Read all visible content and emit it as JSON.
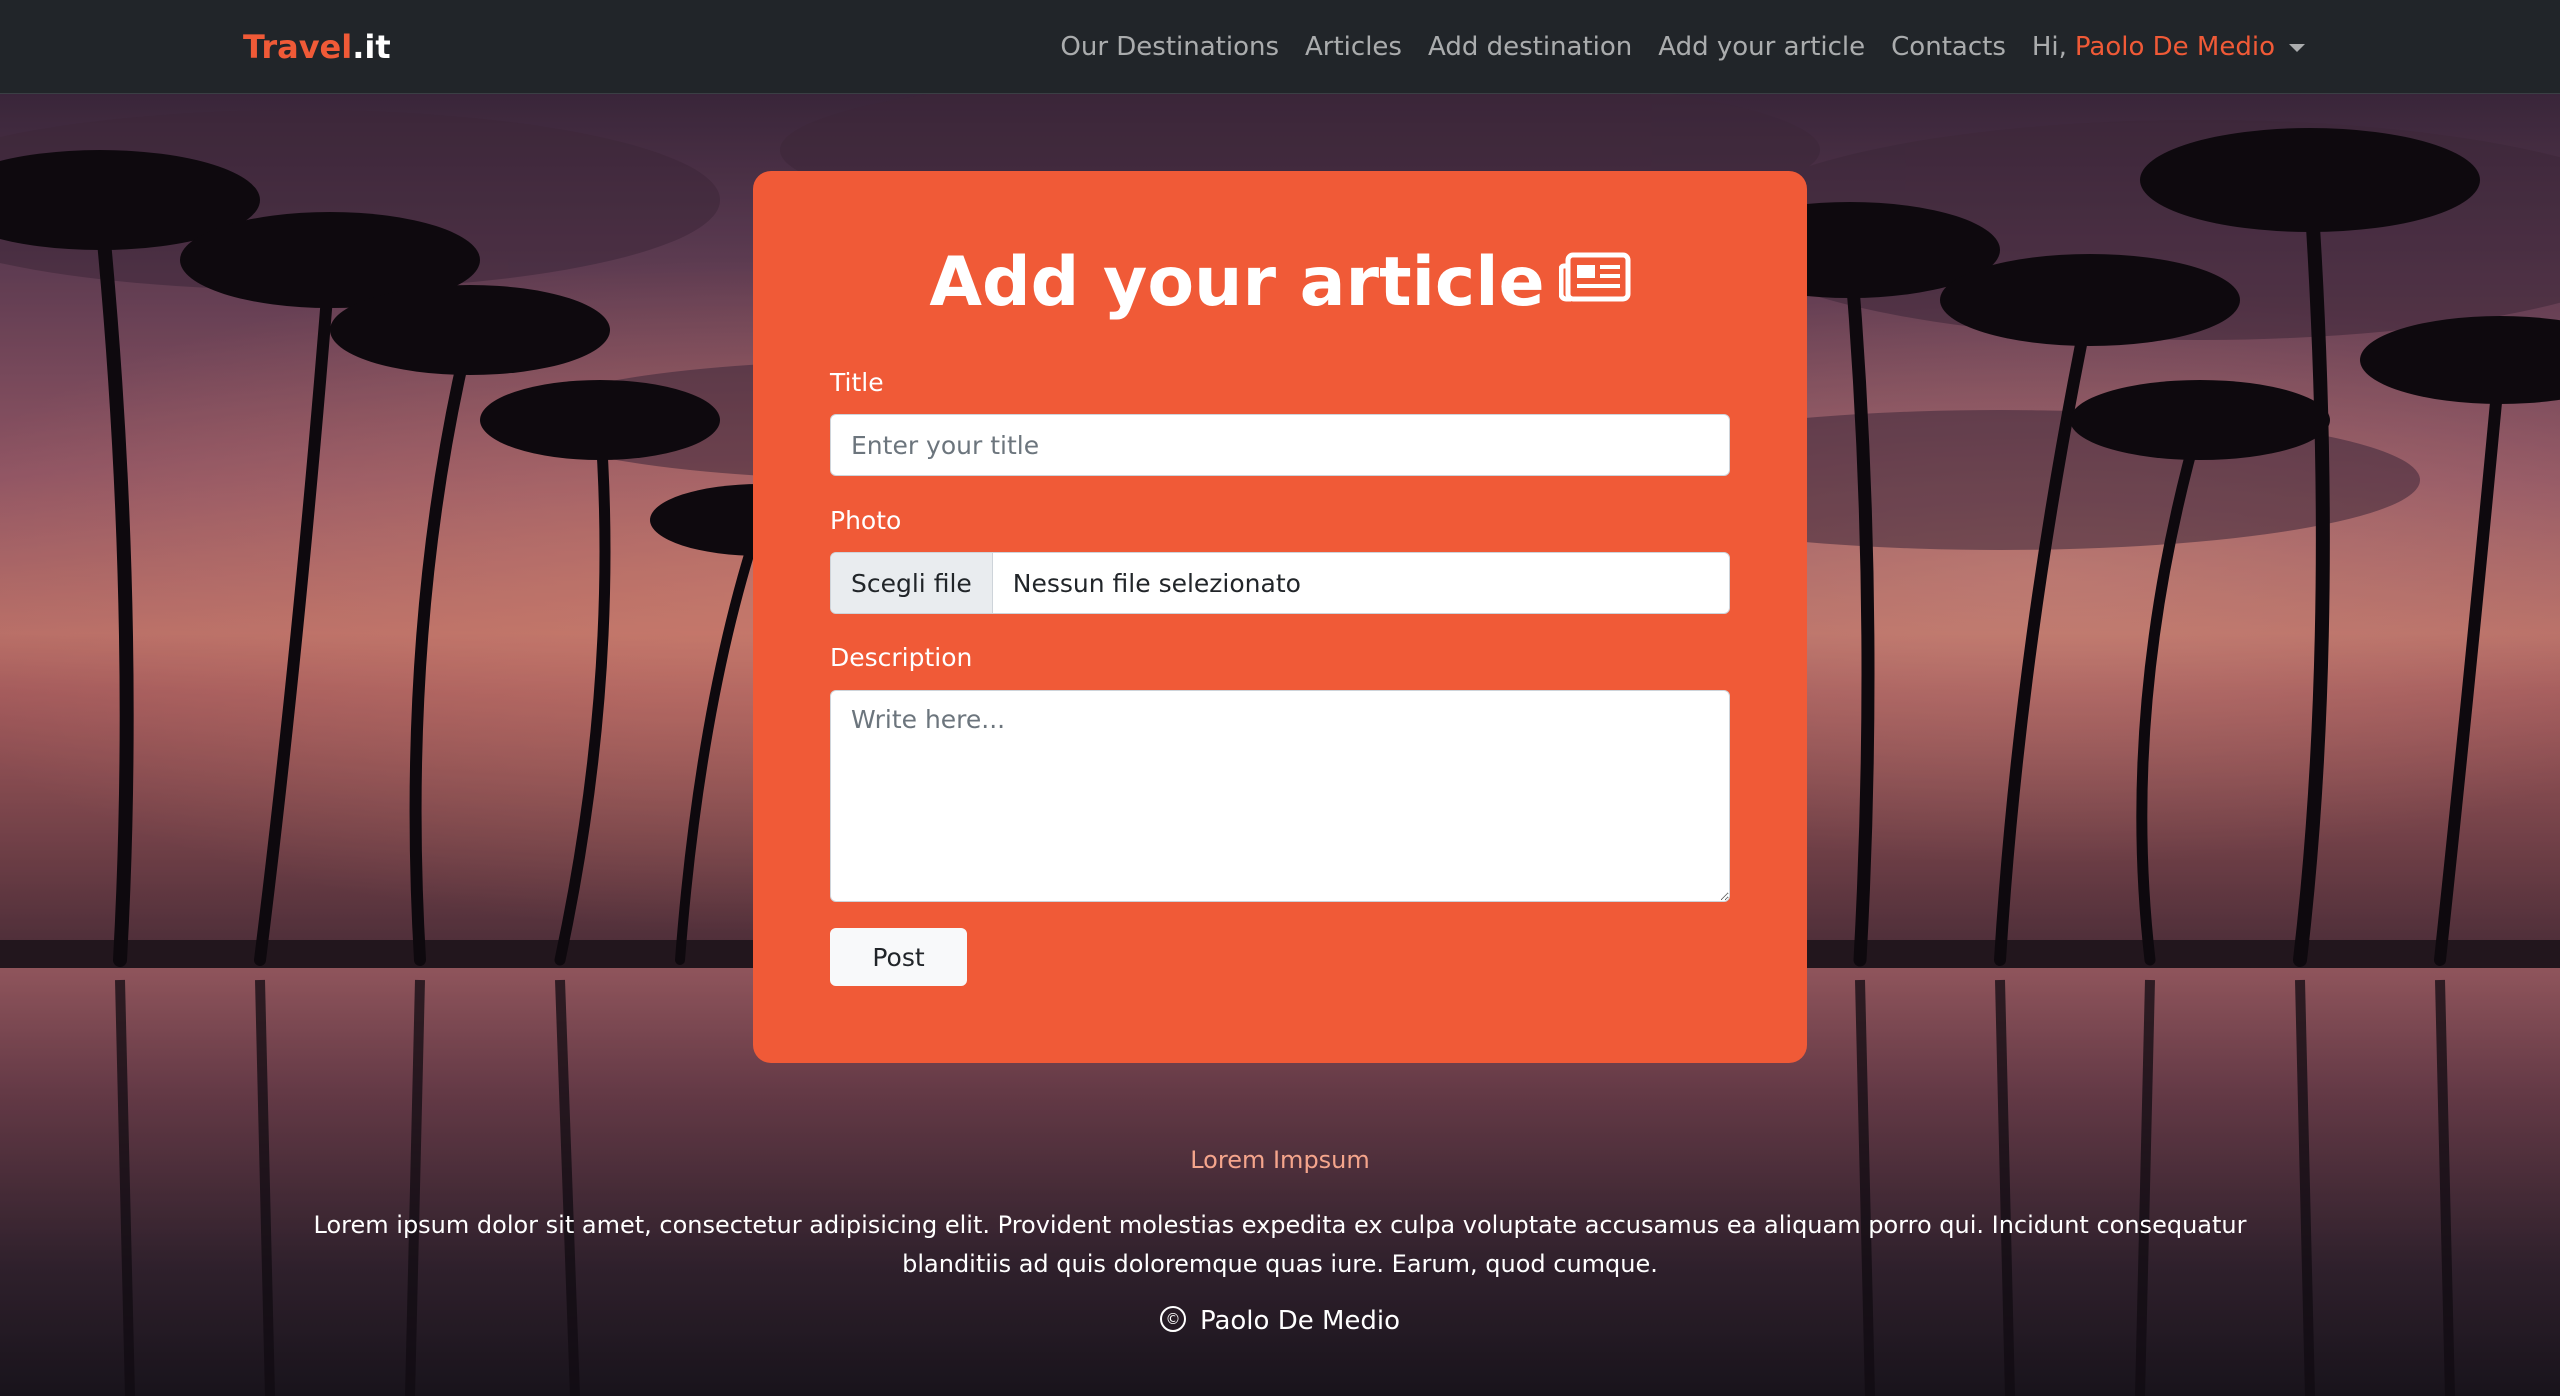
{
  "navbar": {
    "brand_main": "Travel",
    "brand_suffix": ".it",
    "links": [
      "Our Destinations",
      "Articles",
      "Add destination",
      "Add your article",
      "Contacts"
    ],
    "greeting": "Hi,",
    "username": "Paolo De Medio"
  },
  "form": {
    "heading": "Add your article",
    "heading_icon": "newspaper-icon",
    "title_label": "Title",
    "title_placeholder": "Enter your title",
    "photo_label": "Photo",
    "file_button": "Scegli file",
    "file_status": "Nessun file selezionato",
    "description_label": "Description",
    "description_placeholder": "Write here...",
    "submit_label": "Post"
  },
  "footer": {
    "title": "Lorem Impsum",
    "text": "Lorem ipsum dolor sit amet, consectetur adipisicing elit. Provident molestias expedita ex culpa voluptate accusamus ea aliquam porro qui. Incidunt consequatur blanditiis ad quis doloremque quas iure. Earum, quod cumque.",
    "copyright_symbol": "©",
    "author": "Paolo De Medio"
  },
  "colors": {
    "accent": "#f05a37",
    "navbar_bg": "#212529"
  },
  "background": {
    "scene": "tropical sunset with palm trees reflected in pool"
  }
}
